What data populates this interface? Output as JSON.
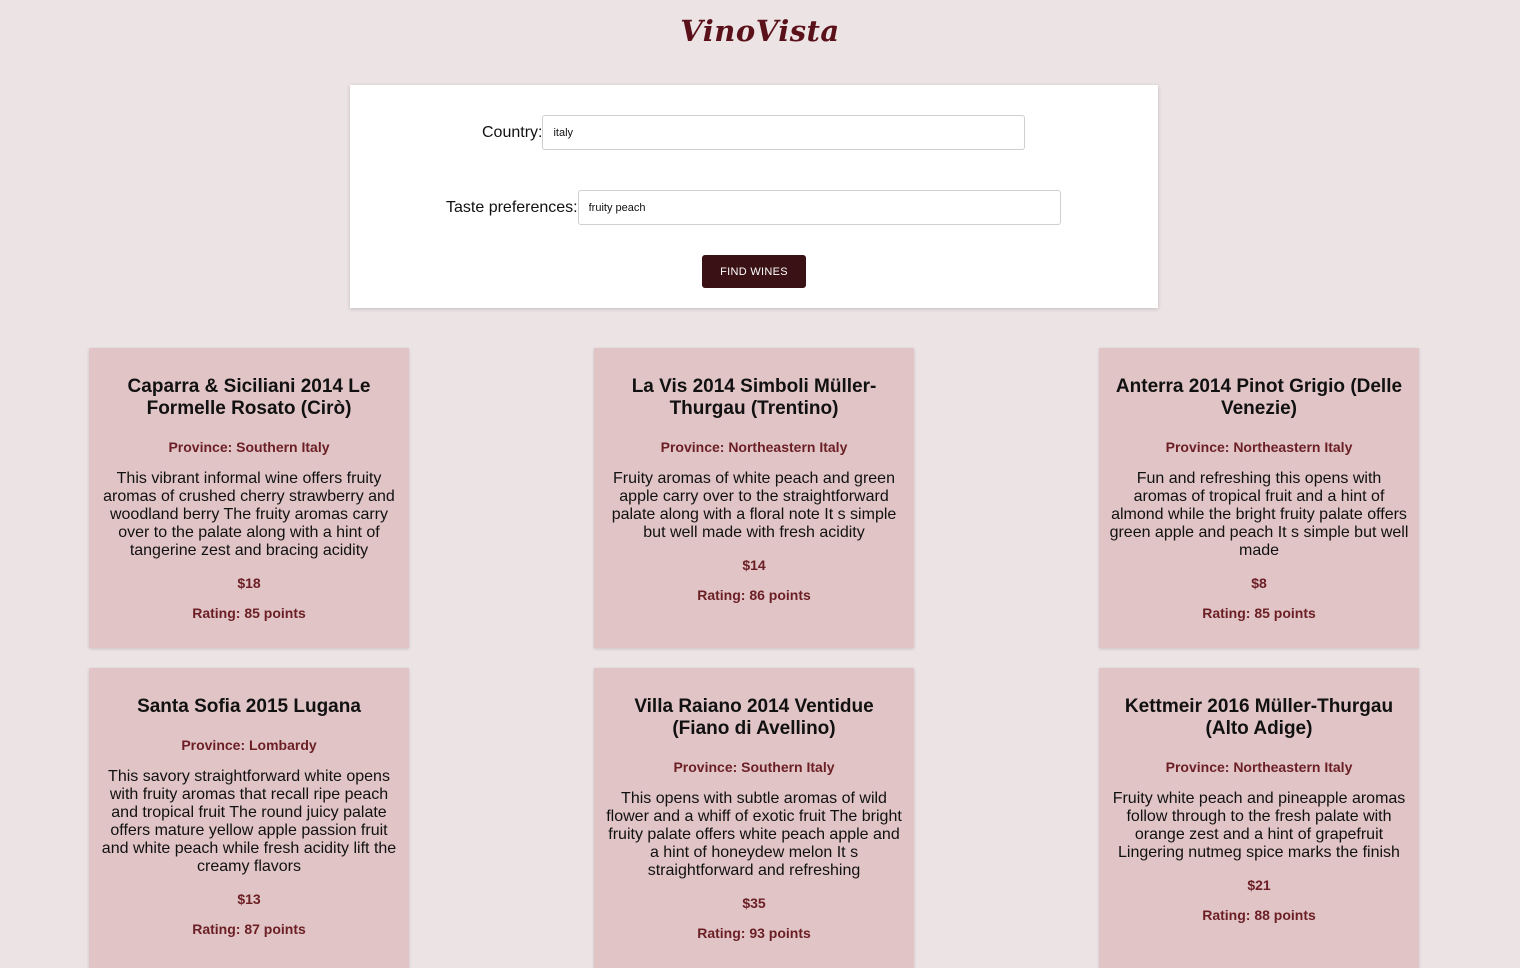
{
  "header": {
    "logo": "VinoVista"
  },
  "search": {
    "country_label": "Country:",
    "country_value": "italy",
    "taste_label": "Taste preferences:",
    "taste_value": "fruity peach",
    "button_label": "FIND WINES"
  },
  "wines": [
    {
      "title": "Caparra & Siciliani 2014 Le Formelle Rosato (Cirò)",
      "province": "Province: Southern Italy",
      "description": "This vibrant informal wine offers fruity aromas of crushed cherry strawberry and woodland berry The fruity aromas carry over to the palate along with a hint of tangerine zest and bracing acidity",
      "price": "$18",
      "rating": "Rating: 85 points"
    },
    {
      "title": "La Vis 2014 Simboli Müller-Thurgau (Trentino)",
      "province": "Province: Northeastern Italy",
      "description": "Fruity aromas of white peach and green apple carry over to the straightforward palate along with a floral note It s simple but well made with fresh acidity",
      "price": "$14",
      "rating": "Rating: 86 points"
    },
    {
      "title": "Anterra 2014 Pinot Grigio (Delle Venezie)",
      "province": "Province: Northeastern Italy",
      "description": "Fun and refreshing this opens with aromas of tropical fruit and a hint of almond while the bright fruity palate offers green apple and peach It s simple but well made",
      "price": "$8",
      "rating": "Rating: 85 points"
    },
    {
      "title": "Santa Sofia 2015 Lugana",
      "province": "Province: Lombardy",
      "description": "This savory straightforward white opens with fruity aromas that recall ripe peach and tropical fruit The round juicy palate offers mature yellow apple passion fruit and white peach while fresh acidity lift the creamy flavors",
      "price": "$13",
      "rating": "Rating: 87 points"
    },
    {
      "title": "Villa Raiano 2014 Ventidue (Fiano di Avellino)",
      "province": "Province: Southern Italy",
      "description": "This opens with subtle aromas of wild flower and a whiff of exotic fruit The bright fruity palate offers white peach apple and a hint of honeydew melon It s straightforward and refreshing",
      "price": "$35",
      "rating": "Rating: 93 points"
    },
    {
      "title": "Kettmeir 2016 Müller-Thurgau (Alto Adige)",
      "province": "Province: Northeastern Italy",
      "description": "Fruity white peach and pineapple aromas follow through to the fresh palate with orange zest and a hint of grapefruit Lingering nutmeg spice marks the finish",
      "price": "$21",
      "rating": "Rating: 88 points"
    }
  ]
}
